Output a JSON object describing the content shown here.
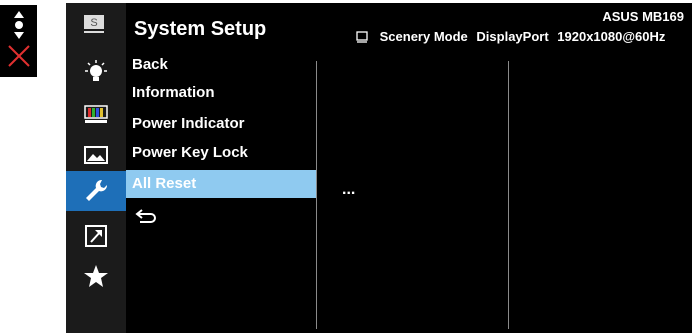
{
  "osd": {
    "title": "System Setup",
    "model": "ASUS MB169",
    "status": {
      "mode": "Scenery Mode",
      "input": "DisplayPort",
      "resolution": "1920x1080@60Hz"
    }
  },
  "sidebar_icons": [
    "s-label-icon",
    "bulb-icon",
    "color-bars-icon",
    "image-icon",
    "wrench-icon",
    "shortcut-arrow-icon",
    "star-icon"
  ],
  "active_icon": "wrench-icon",
  "menu": {
    "items": [
      "Back",
      "Information",
      "Power Indicator",
      "Power Key Lock",
      "All Reset"
    ],
    "selected": "All Reset"
  },
  "submenu": {
    "value": "..."
  },
  "colors": {
    "active_tab": "#1e6fb8",
    "selected_row": "#8fcaf0",
    "close_x": "#e03030"
  }
}
